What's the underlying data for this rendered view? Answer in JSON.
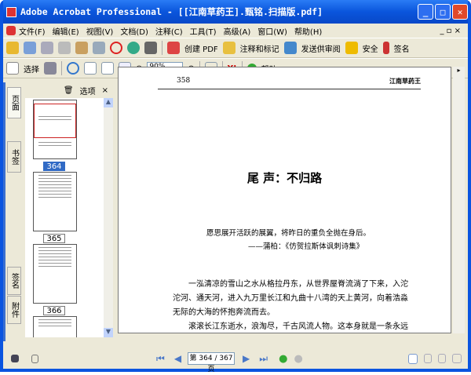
{
  "window": {
    "title": "Adobe Acrobat Professional - [[江南草药王].甄铭.扫描版.pdf]"
  },
  "menu": [
    "文件(F)",
    "编辑(E)",
    "视图(V)",
    "文档(D)",
    "注释(C)",
    "工具(T)",
    "高级(A)",
    "窗口(W)",
    "帮助(H)"
  ],
  "toolbar1": {
    "create_pdf": "创建 PDF",
    "comment": "注释和标记",
    "review": "发送供审阅",
    "secure": "安全",
    "sign": "签名"
  },
  "toolbar2": {
    "select": "选择",
    "zoom": "90%",
    "help": "帮助"
  },
  "side_tabs": [
    "页面",
    "书签",
    "签名",
    "附件"
  ],
  "panel": {
    "options": "选项",
    "pages": [
      "364",
      "365",
      "366"
    ],
    "selected": "364"
  },
  "document": {
    "page_number": "358",
    "running_head": "江南草药王",
    "chapter_title": "尾  声：不归路",
    "epigraph": "愿思展开活跃的展翼，将昨日的重负全抛在身后。",
    "epigraph_source": "——蒲柏：《仿贺拉斯体讽刺诗集》",
    "paragraphs": [
      "一泓清凉的雪山之水从格拉丹东，从世界屋脊流淌了下来，入沱沱河、通天河，进入九万里长江和九曲十八湾的天上黄河，向着浩淼无际的大海的怀抱奔流而去。",
      "滚滚长江东逝水，浪淘尽，千古风流人物。这本身就是一条永远没有归程的生命之旅。其实对于一个学人，一个苦苦追寻"
    ]
  },
  "status": {
    "page_display": "第 364 / 367 页"
  }
}
